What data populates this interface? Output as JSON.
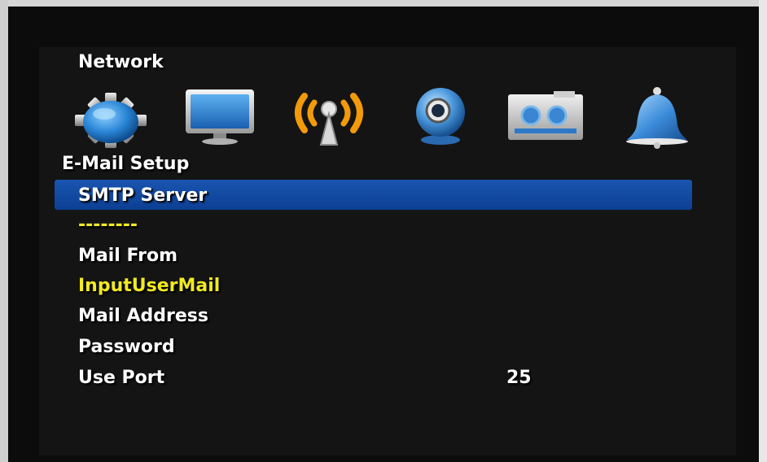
{
  "header": {
    "title": "Network"
  },
  "icons": [
    {
      "name": "gear-icon"
    },
    {
      "name": "monitor-icon"
    },
    {
      "name": "wireless-signal-icon"
    },
    {
      "name": "webcam-icon"
    },
    {
      "name": "recorder-icon"
    },
    {
      "name": "bell-icon"
    }
  ],
  "section": {
    "title": "E-Mail Setup"
  },
  "menu": {
    "smtp_server_label": "SMTP Server",
    "smtp_server_value": "--------",
    "mail_from_label": "Mail From",
    "mail_from_value": "InputUserMail",
    "mail_address_label": "Mail Address",
    "password_label": "Password",
    "use_port_label": "Use Port",
    "use_port_value": "25"
  },
  "colors": {
    "highlight": "#0c3f93",
    "accent_yellow": "#f2ea1e",
    "selected_icon_orange": "#f39a0a",
    "background": "#0c0c0c"
  }
}
